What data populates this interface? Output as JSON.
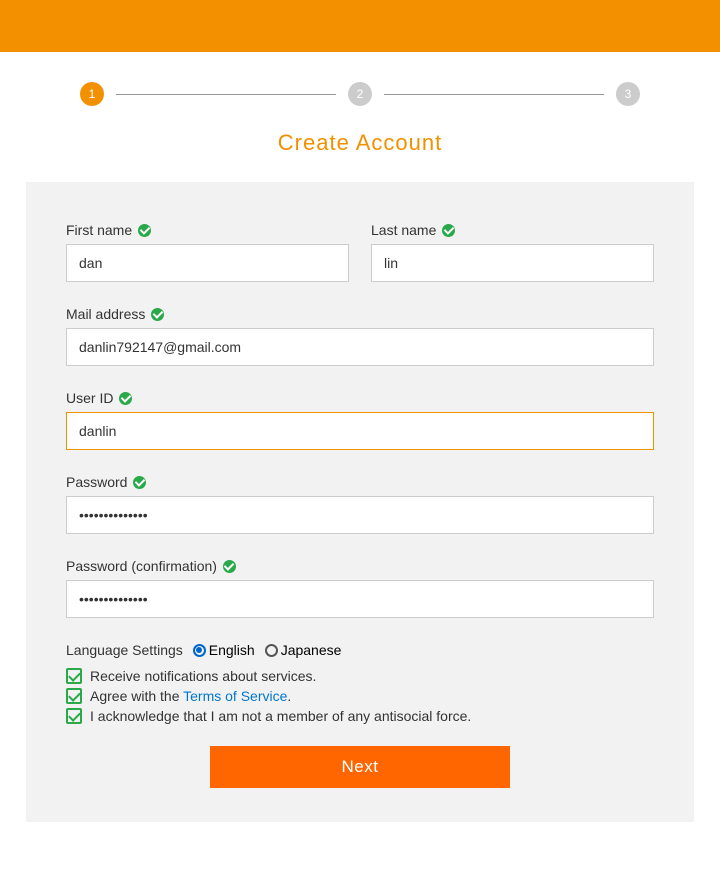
{
  "stepper": {
    "steps": [
      "1",
      "2",
      "3"
    ],
    "active": 0
  },
  "title": "Create Account",
  "fields": {
    "first_name": {
      "label": "First name",
      "value": "dan"
    },
    "last_name": {
      "label": "Last name",
      "value": "lin"
    },
    "mail": {
      "label": "Mail address",
      "value": "danlin792147@gmail.com"
    },
    "user_id": {
      "label": "User ID",
      "value": "danlin"
    },
    "password": {
      "label": "Password",
      "value": "••••••••••••••"
    },
    "password_confirm": {
      "label": "Password (confirmation)",
      "value": "••••••••••••••"
    }
  },
  "language": {
    "label": "Language Settings",
    "options": {
      "english": "English",
      "japanese": "Japanese"
    },
    "selected": "english"
  },
  "checkboxes": {
    "notifications": "Receive notifications about services.",
    "agree_prefix": "Agree with the ",
    "tos_link": "Terms of Service",
    "agree_suffix": ".",
    "antisocial": "I acknowledge that I am not a member of any antisocial force."
  },
  "next_button": "Next"
}
